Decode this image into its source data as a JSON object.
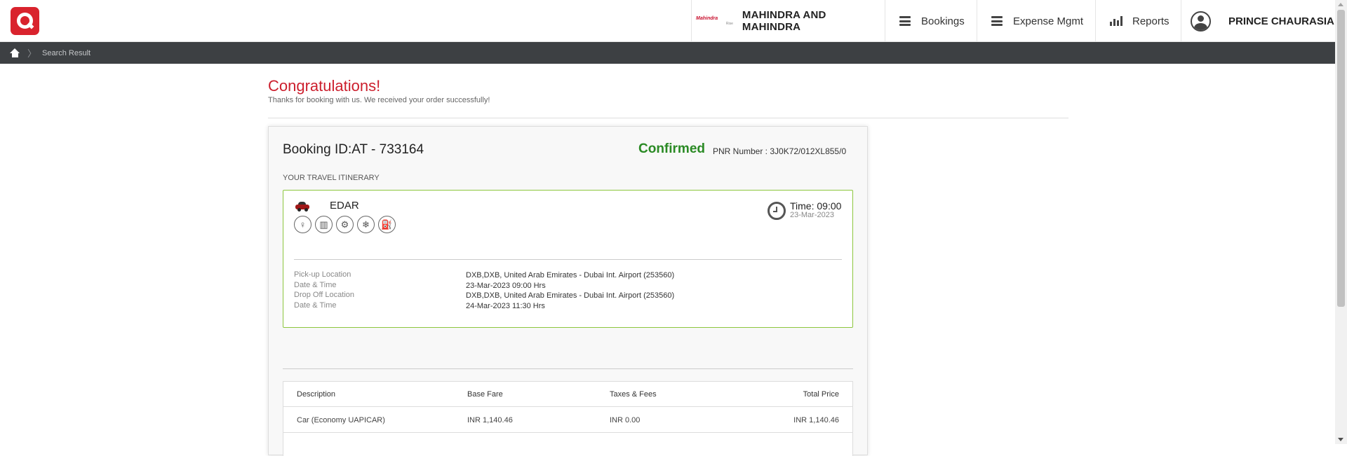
{
  "header": {
    "company_logo_text": "Mahindra",
    "company_logo_subtext": "Rise",
    "company_name": "MAHINDRA AND MAHINDRA",
    "nav": {
      "bookings": "Bookings",
      "expense": "Expense Mgmt",
      "reports": "Reports"
    },
    "user_name": "PRINCE CHAURASIA"
  },
  "breadcrumb": {
    "current": "Search Result"
  },
  "confirmation": {
    "title": "Congratulations!",
    "message": "Thanks for booking with us. We received your order successfully!"
  },
  "booking": {
    "id_label": "Booking ID:AT - 733164",
    "status": "Confirmed",
    "pnr": "PNR Number : 3J0K72/012XL855/0",
    "itinerary_label": "YOUR TRAVEL ITINERARY",
    "car": {
      "name": "EDAR",
      "amenity_icons": [
        "person-icon",
        "luggage-icon",
        "transmission-icon",
        "ac-icon",
        "fuel-icon"
      ],
      "time": "Time: 09:00",
      "date": "23-Mar-2023"
    },
    "details": [
      {
        "label": "Pick-up Location",
        "value": "DXB,DXB, United Arab Emirates - Dubai Int. Airport (253560)"
      },
      {
        "label": "Date & Time",
        "value": "23-Mar-2023 09:00 Hrs"
      },
      {
        "label": "Drop Off Location",
        "value": "DXB,DXB, United Arab Emirates - Dubai Int. Airport (253560)"
      },
      {
        "label": "Date & Time",
        "value": "24-Mar-2023 11:30 Hrs"
      }
    ]
  },
  "fare_table": {
    "headers": [
      "Description",
      "Base Fare",
      "Taxes & Fees",
      "Total Price"
    ],
    "rows": [
      [
        "Car (Economy UAPICAR)",
        "INR 1,140.46",
        "INR 0.00",
        "INR 1,140.46"
      ]
    ]
  },
  "colors": {
    "brand_red": "#d9232d",
    "congrats_red": "#cc1f2d",
    "confirmed_green": "#2a8a24",
    "itinerary_border": "#8cc63e",
    "breadcrumb_bg": "#3d4043"
  }
}
